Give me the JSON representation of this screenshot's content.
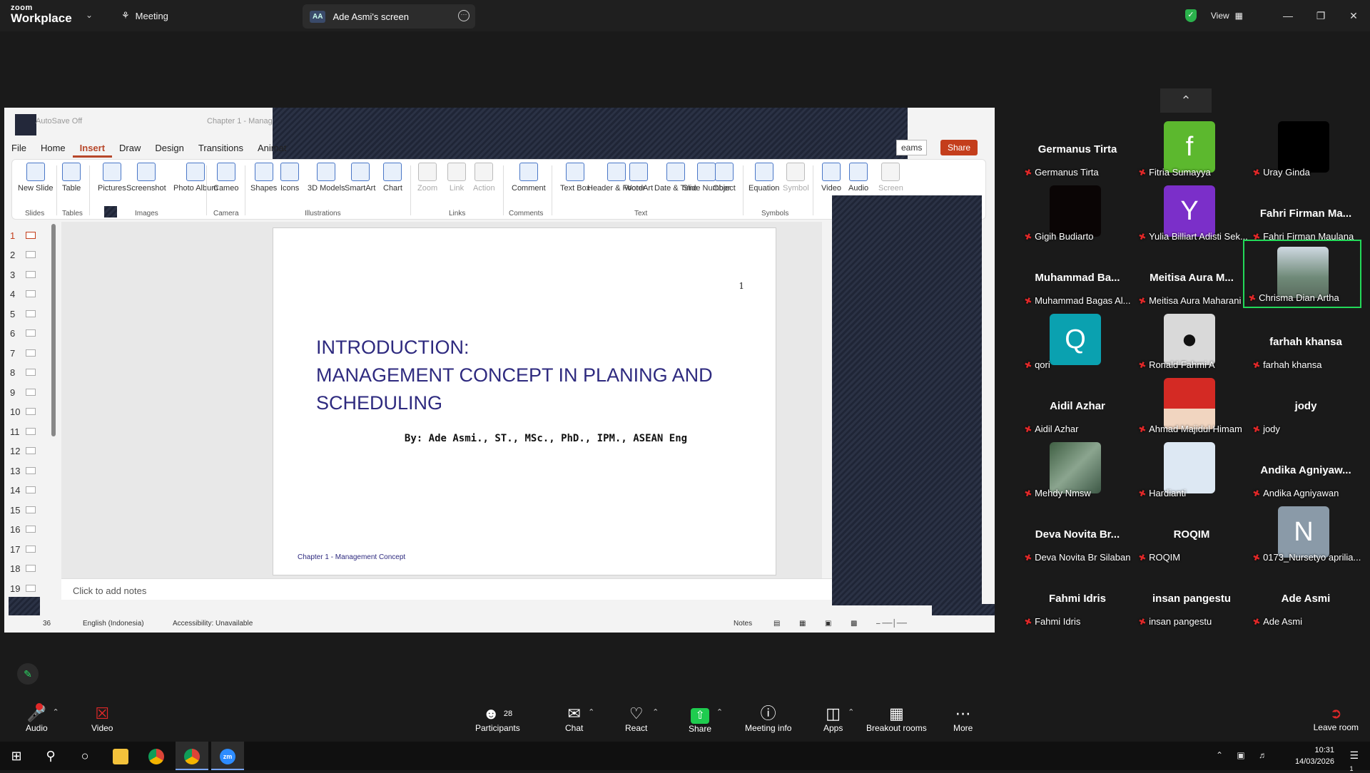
{
  "topbar": {
    "logo_line1": "zoom",
    "logo_line2": "Workplace",
    "meeting_label": "Meeting",
    "screen_badge": "AA",
    "screen_tab_label": "Ade Asmi's screen",
    "view_label": "View"
  },
  "ppt": {
    "autosave": "AutoSave",
    "autosave_state": "Off",
    "doc_title": "Chapter 1 - Manag",
    "menus": [
      "File",
      "Home",
      "Insert",
      "Draw",
      "Design",
      "Transitions",
      "Animat"
    ],
    "active_menu": "Insert",
    "teams_label": "eams",
    "share_label": "Share",
    "ribbon": {
      "new_slide": "New Slide",
      "table": "Table",
      "pictures": "Pictures",
      "screenshot": "Screenshot",
      "photo_album": "Photo Album",
      "cameo": "Cameo",
      "shapes": "Shapes",
      "icons": "Icons",
      "models3d": "3D Models",
      "smartart": "SmartArt",
      "chart": "Chart",
      "zoom": "Zoom",
      "link": "Link",
      "action": "Action",
      "comment": "Comment",
      "text_box": "Text Box",
      "header_footer": "Header & Footer",
      "wordart": "WordArt",
      "date_time": "Date & Time",
      "slide_number": "Slide Number",
      "object": "Object",
      "equation": "Equation",
      "symbol": "Symbol",
      "video": "Video",
      "audio": "Audio",
      "screen": "Screen",
      "groups": {
        "slides": "Slides",
        "tables": "Tables",
        "images": "Images",
        "camera": "Camera",
        "illustrations": "Illustrations",
        "links": "Links",
        "comments": "Comments",
        "text": "Text",
        "symbols": "Symbols"
      }
    },
    "thumbnails": [
      "1",
      "2",
      "3",
      "4",
      "5",
      "6",
      "7",
      "8",
      "9",
      "10",
      "11",
      "12",
      "13",
      "14",
      "15",
      "16",
      "17",
      "18",
      "19"
    ],
    "slide": {
      "number": "1",
      "title_line1": "INTRODUCTION:",
      "title_line2": "MANAGEMENT CONCEPT IN PLANING AND",
      "title_line3": "SCHEDULING",
      "byline": "By: Ade Asmi., ST., MSc., PhD., IPM., ASEAN Eng",
      "footer": "Chapter 1 - Management Concept"
    },
    "notes_placeholder": "Click to add notes",
    "status": {
      "slide_count": "36",
      "language": "English (Indonesia)",
      "accessibility": "Accessibility: Unavailable",
      "notes_btn": "Notes"
    }
  },
  "gallery": [
    {
      "big": "Germanus Tirta",
      "label": "Germanus Tirta"
    },
    {
      "avatar_letter": "f",
      "avatar_color": "#5cb82e",
      "label": "Fitria Sumayya"
    },
    {
      "avatar_color": "#000000",
      "label": "Uray Ginda"
    },
    {
      "avatar_color": "#0a0505",
      "label": "Gigih Budiarto"
    },
    {
      "avatar_letter": "Y",
      "avatar_color": "#7b2fc9",
      "label": "Yulia Billiart Adisti Sek..."
    },
    {
      "big": "Fahri Firman Ma...",
      "label": "Fahri Firman Maulana"
    },
    {
      "big": "Muhammad Ba...",
      "label": "Muhammad Bagas Al..."
    },
    {
      "big": "Meitisa Aura M...",
      "label": "Meitisa Aura Maharani"
    },
    {
      "avatar_color": "#6f8a78",
      "label": "Chrisma Dian Artha",
      "active": true
    },
    {
      "avatar_letter": "Q",
      "avatar_color": "#0aa1b0",
      "label": "qori"
    },
    {
      "avatar_color": "#d9d9d9",
      "label": "Ronald Fahmi A"
    },
    {
      "big": "farhah khansa",
      "label": "farhah khansa"
    },
    {
      "big": "Aidil Azhar",
      "label": "Aidil Azhar"
    },
    {
      "avatar_color": "#d42a24",
      "label": "Ahmad Majidul Himam"
    },
    {
      "big": "jody",
      "label": "jody"
    },
    {
      "avatar_color": "#4d6e5a",
      "label": "Mehdy Nmsw"
    },
    {
      "avatar_color": "#dde8f3",
      "label": "Hardianti"
    },
    {
      "big": "Andika  Agniyaw...",
      "label": "Andika Agniyawan"
    },
    {
      "big": "Deva Novita Br...",
      "label": "Deva Novita Br Silaban"
    },
    {
      "big": "ROQIM",
      "label": "ROQIM"
    },
    {
      "avatar_letter": "N",
      "avatar_color": "#8a9aa8",
      "label": "0173_Nursetyo aprilia..."
    },
    {
      "big": "Fahmi Idris",
      "label": "Fahmi Idris"
    },
    {
      "big": "insan pangestu",
      "label": "insan pangestu"
    },
    {
      "big": "Ade Asmi",
      "label": "Ade Asmi"
    }
  ],
  "toolbar": {
    "audio": "Audio",
    "video": "Video",
    "participants": "Participants",
    "participants_count": "28",
    "chat": "Chat",
    "react": "React",
    "share": "Share",
    "meeting_info": "Meeting info",
    "apps": "Apps",
    "breakout": "Breakout rooms",
    "more": "More",
    "leave": "Leave room"
  },
  "taskbar": {
    "time": "10:31",
    "date": "14/03/2026",
    "zoom_label": "zm",
    "notif_count": "1"
  }
}
